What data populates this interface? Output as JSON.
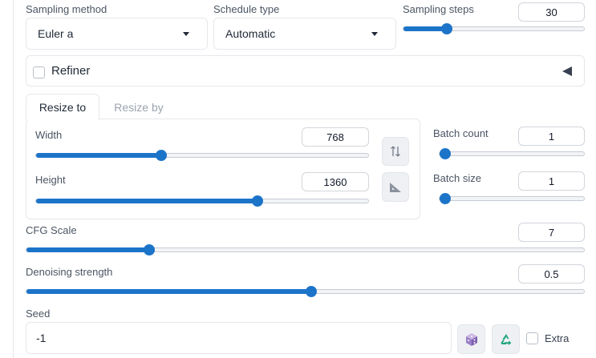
{
  "sampling": {
    "method_label": "Sampling method",
    "method_value": "Euler a",
    "schedule_label": "Schedule type",
    "schedule_value": "Automatic",
    "steps_label": "Sampling steps",
    "steps_value": "30",
    "steps_fraction": 0.21
  },
  "refiner": {
    "label": "Refiner",
    "checked": false,
    "collapse_icon": "triangle-left-icon"
  },
  "resize_tabs": [
    {
      "label": "Resize to",
      "active": true
    },
    {
      "label": "Resize by",
      "active": false
    }
  ],
  "width": {
    "label": "Width",
    "value": "768",
    "fraction": 0.36
  },
  "height": {
    "label": "Height",
    "value": "1360",
    "fraction": 0.65
  },
  "swap_icon": "swap-vertical-icon",
  "aspect_icon": "ruler-triangle-icon",
  "batch_count": {
    "label": "Batch count",
    "value": "1",
    "fraction": 0.0
  },
  "batch_size": {
    "label": "Batch size",
    "value": "1",
    "fraction": 0.0
  },
  "cfg": {
    "label": "CFG Scale",
    "value": "7",
    "fraction": 0.21
  },
  "denoise": {
    "label": "Denoising strength",
    "value": "0.5",
    "fraction": 0.5
  },
  "seed": {
    "label": "Seed",
    "value": "-1",
    "random_icon": "dice-icon",
    "reuse_icon": "recycle-icon",
    "extra_label": "Extra",
    "extra_checked": false
  },
  "colors": {
    "accent": "#1c74c9",
    "track": "#f3f4f6",
    "border": "#e5e7eb"
  }
}
